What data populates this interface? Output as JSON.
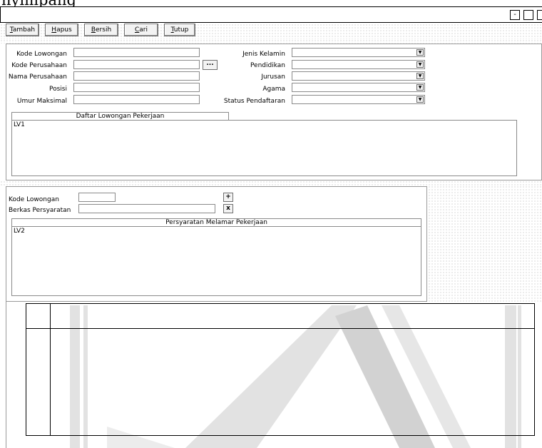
{
  "top_text": "nyimpang",
  "window": {
    "buttons": [
      {
        "name": "minimize-button",
        "glyph": "-"
      },
      {
        "name": "maximize-button",
        "glyph": ""
      },
      {
        "name": "close-button",
        "glyph": ""
      }
    ]
  },
  "toolbar": {
    "buttons": [
      {
        "key": "T",
        "rest": "ambah"
      },
      {
        "key": "H",
        "rest": "apus"
      },
      {
        "key": "B",
        "rest": "ersih"
      },
      {
        "key": "C",
        "rest": "ari"
      },
      {
        "key": "T",
        "rest": "utup"
      }
    ]
  },
  "form1": {
    "kode_lowongan": {
      "label": "Kode Lowongan",
      "value": ""
    },
    "kode_perusahaan": {
      "label": "Kode Perusahaan",
      "value": ""
    },
    "browse_label": "...",
    "nama_perusahaan": {
      "label": "Nama Perusahaan",
      "value": ""
    },
    "posisi": {
      "label": "Posisi",
      "value": ""
    },
    "umur_maksimal": {
      "label": "Umur Maksimal",
      "value": ""
    },
    "jenis_kelamin": {
      "label": "Jenis Kelamin",
      "value": ""
    },
    "pendidikan": {
      "label": "Pendidikan",
      "value": ""
    },
    "jurusan": {
      "label": "Jurusan",
      "value": ""
    },
    "agama": {
      "label": "Agama",
      "value": ""
    },
    "status_pendaftaran": {
      "label": "Status Pendaftaran",
      "value": ""
    },
    "list_title": "Daftar Lowongan Pekerjaan",
    "list_content": "LV1"
  },
  "form2": {
    "kode_lowongan": {
      "label": "Kode Lowongan",
      "value": ""
    },
    "berkas": {
      "label": "Berkas Persyaratan",
      "value": ""
    },
    "add_label": "+",
    "remove_label": "x",
    "list_title": "Persyaratan Melamar Pekerjaan",
    "list_content": "LV2"
  },
  "colors": {
    "watermark": "#e2e2e2",
    "border": "#8a8a8a"
  }
}
